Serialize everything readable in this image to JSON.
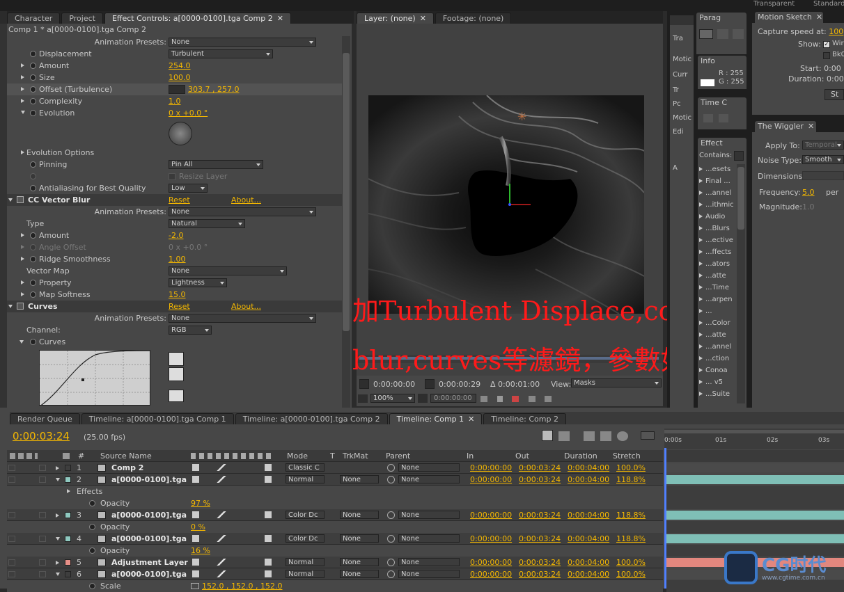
{
  "left_tabs": [
    "Character",
    "Project",
    "Effect Controls: a[0000-0100].tga Comp 2"
  ],
  "comp_title": "Comp 1 * a[0000-0100].tga Comp 2",
  "effect_rows": [
    {
      "indent": 0,
      "label": "Animation Presets:",
      "value": "None",
      "kind": "preset"
    },
    {
      "indent": 1,
      "label": "Displacement",
      "value": "Turbulent",
      "kind": "dropdown"
    },
    {
      "indent": 1,
      "label": "Amount",
      "value": "254.0",
      "kind": "value",
      "tri": true
    },
    {
      "indent": 1,
      "label": "Size",
      "value": "100.0",
      "kind": "value",
      "tri": true
    },
    {
      "indent": 1,
      "label": "Offset (Turbulence)",
      "value": "303.7 , 257.0",
      "kind": "point",
      "tri": true
    },
    {
      "indent": 1,
      "label": "Complexity",
      "value": "1.0",
      "kind": "value",
      "tri": true
    },
    {
      "indent": 1,
      "label": "Evolution",
      "value": "0 x +0.0 °",
      "kind": "value",
      "tri": true,
      "open": true
    }
  ],
  "effect_rows2": [
    {
      "label": "Evolution Options",
      "value": "",
      "kind": "group"
    },
    {
      "label": "Pinning",
      "value": "Pin All",
      "kind": "dropdown"
    },
    {
      "label": "",
      "value": "Resize Layer",
      "kind": "check"
    },
    {
      "label": "Antialiasing for Best Quality",
      "value": "Low",
      "kind": "dropdown"
    }
  ],
  "cc_vector_blur": {
    "title": "CC Vector Blur",
    "reset": "Reset",
    "about": "About...",
    "preset_label": "Animation Presets:",
    "preset": "None",
    "rows": [
      {
        "label": "Type",
        "value": "Natural",
        "kind": "dropdown"
      },
      {
        "label": "Amount",
        "value": "-2.0",
        "kind": "value"
      },
      {
        "label": "Angle Offset",
        "value": "0 x +0.0 °",
        "kind": "dis"
      },
      {
        "label": "Ridge Smoothness",
        "value": "1.00",
        "kind": "value"
      },
      {
        "label": "Vector Map",
        "value": "None",
        "kind": "dropdown"
      },
      {
        "label": "Property",
        "value": "Lightness",
        "kind": "dropdown"
      },
      {
        "label": "Map Softness",
        "value": "15.0",
        "kind": "value"
      }
    ]
  },
  "curves": {
    "title": "Curves",
    "reset": "Reset",
    "about": "About...",
    "preset_label": "Animation Presets:",
    "preset": "None",
    "channel_label": "Channel:",
    "channel": "RGB",
    "curves_label": "Curves"
  },
  "layer_tabs": [
    "Layer: (none)",
    "Footage: (none)"
  ],
  "viewer": {
    "time1": "0:00:00:00",
    "time2": "0:00:00:29",
    "delta": "Δ 0:00:01:00",
    "view_label": "View:",
    "view": "Masks",
    "zoom": "100%",
    "time3": "0:00:00:00"
  },
  "overlay": {
    "line1": "加Turbulent Displace,cc vector",
    "line2": "blur,curves等濾鏡，參數如圖",
    "color": "#ff1a1a"
  },
  "right_col1": {
    "tab": "Parag",
    "info_tab": "Info",
    "r": "R : 255",
    "g": "G : 255",
    "time_tab": "Time C",
    "effect_tab": "Effect",
    "contains": "Contains:",
    "items": [
      "...esets",
      "Final ...",
      "...annel",
      "...ithmic",
      "Audio",
      "...Blurs",
      "...ective",
      "...ffects",
      "...ators",
      "...atte",
      "...Time",
      "...arpen",
      "...",
      "...Color",
      "...atte",
      "...annel",
      "...ction",
      "Conoa",
      "... v5",
      "...Suite"
    ]
  },
  "right_col0": {
    "labels": [
      "Tra",
      "Motic",
      "Curr",
      "Tr",
      "Pc",
      "Motic",
      "Edi",
      "A"
    ]
  },
  "motion_sketch": {
    "tab": "Motion Sketch",
    "capture_label": "Capture speed at:",
    "capture": "100",
    "show_label": "Show:",
    "wf": "Wire",
    "bg": "Bk0",
    "start_label": "Start:",
    "start": "0:00",
    "duration_label": "Duration:",
    "duration": "0:00",
    "button": "St",
    "top": "Transparent",
    "std": "Standard"
  },
  "wiggler": {
    "tab": "The Wiggler",
    "apply_label": "Apply To:",
    "apply": "Temporal",
    "noise_label": "Noise Type:",
    "noise": "Smooth",
    "dim_label": "Dimensions:",
    "freq_label": "Frequency:",
    "freq": "5.0",
    "per": "per",
    "mag_label": "Magnitude:",
    "mag": "1.0"
  },
  "bottom_tabs": [
    "Render Queue",
    "Timeline: a[0000-0100].tga Comp 1",
    "Timeline: a[0000-0100].tga Comp 2",
    "Timeline: Comp 1",
    "Timeline: Comp 2"
  ],
  "timeline": {
    "current_time": "0:00:03:24",
    "fps": "(25.00 fps)",
    "headers": {
      "num": "#",
      "source": "Source Name",
      "mode": "Mode",
      "t": "T",
      "trkmat": "TrkMat",
      "parent": "Parent",
      "in": "In",
      "out": "Out",
      "duration": "Duration",
      "stretch": "Stretch"
    },
    "ruler": [
      "0:00s",
      "01s",
      "02s",
      "03s"
    ],
    "rows": [
      {
        "type": "layer",
        "num": "1",
        "name": "Comp 2",
        "color": "#3e3e3e",
        "mode": "Classic C",
        "trk": "",
        "parent": "None",
        "in": "0:00:00:00",
        "out": "0:00:03:24",
        "dur": "0:00:04:00",
        "stretch": "100.0%",
        "bar": "#4a4a4a",
        "open": false
      },
      {
        "type": "layer",
        "num": "2",
        "name": "a[0000-0100].tga",
        "color": "#8fc9c0",
        "mode": "Normal",
        "trk": "None",
        "parent": "None",
        "in": "0:00:00:00",
        "out": "0:00:03:24",
        "dur": "0:00:04:00",
        "stretch": "118.8%",
        "bar": "#7fbfb6",
        "open": true
      },
      {
        "type": "sub",
        "label": "Effects",
        "value": ""
      },
      {
        "type": "sub2",
        "label": "Opacity",
        "value": "97 %"
      },
      {
        "type": "layer",
        "num": "3",
        "name": "a[0000-0100].tga",
        "color": "#8fc9c0",
        "mode": "Color Dc",
        "trk": "None",
        "parent": "None",
        "in": "0:00:00:00",
        "out": "0:00:03:24",
        "dur": "0:00:04:00",
        "stretch": "118.8%",
        "bar": "#7fbfb6",
        "open": false
      },
      {
        "type": "sub2",
        "label": "Opacity",
        "value": "0 %"
      },
      {
        "type": "layer",
        "num": "4",
        "name": "a[0000-0100].tga",
        "color": "#8fc9c0",
        "mode": "Color Dc",
        "trk": "None",
        "parent": "None",
        "in": "0:00:00:00",
        "out": "0:00:03:24",
        "dur": "0:00:04:00",
        "stretch": "118.8%",
        "bar": "#7fbfb6",
        "open": true
      },
      {
        "type": "sub2",
        "label": "Opacity",
        "value": "16 %"
      },
      {
        "type": "layer",
        "num": "5",
        "name": "Adjustment Layer",
        "color": "#e89088",
        "mode": "Normal",
        "trk": "None",
        "parent": "None",
        "in": "0:00:00:00",
        "out": "0:00:03:24",
        "dur": "0:00:04:00",
        "stretch": "100.0%",
        "bar": "#e2877e",
        "open": false
      },
      {
        "type": "layer",
        "num": "6",
        "name": "a[0000-0100].tga",
        "color": "#3e3e3e",
        "mode": "Normal",
        "trk": "None",
        "parent": "None",
        "in": "0:00:00:00",
        "out": "0:00:03:24",
        "dur": "0:00:04:00",
        "stretch": "100.0%",
        "bar": "#4a4a4a",
        "open": true
      },
      {
        "type": "sub2",
        "label": "Scale",
        "value": "152.0 , 152.0 , 152.0"
      }
    ]
  },
  "watermark": {
    "brand": "CG时代",
    "url": "www.cgtime.com.cn"
  }
}
